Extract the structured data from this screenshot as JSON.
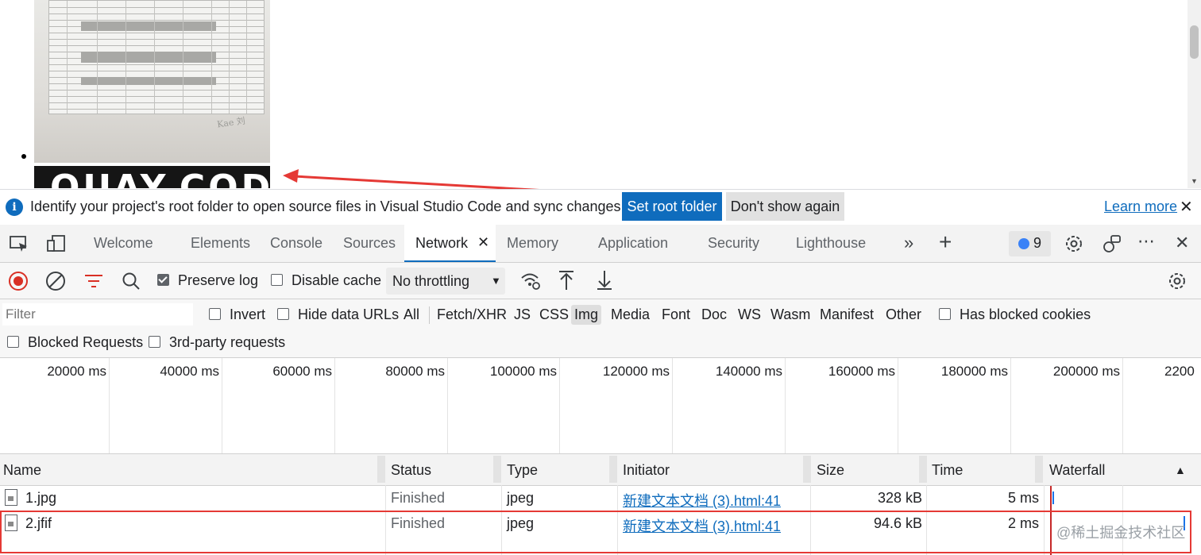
{
  "preview": {
    "photo2_text": "OUAY.COD",
    "signature": "Kae 刘"
  },
  "infobar": {
    "message": "Identify your project's root folder to open source files in Visual Studio Code and sync changes.",
    "set_root_label": "Set root folder",
    "dont_show_label": "Don't show again",
    "learn_more_label": "Learn more"
  },
  "tabs": [
    {
      "label": "Welcome"
    },
    {
      "label": "Elements"
    },
    {
      "label": "Console"
    },
    {
      "label": "Sources"
    },
    {
      "label": "Network"
    },
    {
      "label": "Memory"
    },
    {
      "label": "Application"
    },
    {
      "label": "Security"
    },
    {
      "label": "Lighthouse"
    }
  ],
  "issues_count": "9",
  "toolbar": {
    "preserve_log_label": "Preserve log",
    "preserve_log_checked": true,
    "disable_cache_label": "Disable cache",
    "disable_cache_checked": false,
    "throttling_value": "No throttling"
  },
  "filter": {
    "placeholder": "Filter",
    "invert_label": "Invert",
    "hide_data_urls_label": "Hide data URLs",
    "types": [
      "All",
      "Fetch/XHR",
      "JS",
      "CSS",
      "Img",
      "Media",
      "Font",
      "Doc",
      "WS",
      "Wasm",
      "Manifest",
      "Other"
    ],
    "selected_type": "Img",
    "has_blocked_cookies_label": "Has blocked cookies",
    "blocked_requests_label": "Blocked Requests",
    "third_party_label": "3rd-party requests"
  },
  "overview_ticks": [
    "20000 ms",
    "40000 ms",
    "60000 ms",
    "80000 ms",
    "100000 ms",
    "120000 ms",
    "140000 ms",
    "160000 ms",
    "180000 ms",
    "200000 ms",
    "2200"
  ],
  "table": {
    "columns": [
      "Name",
      "Status",
      "Type",
      "Initiator",
      "Size",
      "Time",
      "Waterfall"
    ],
    "rows": [
      {
        "name": "1.jpg",
        "status": "Finished",
        "type": "jpeg",
        "initiator": "新建文本文档 (3).html:41",
        "size": "328 kB",
        "time": "5 ms"
      },
      {
        "name": "2.jfif",
        "status": "Finished",
        "type": "jpeg",
        "initiator": "新建文本文档 (3).html:41",
        "size": "94.6 kB",
        "time": "2 ms"
      }
    ]
  },
  "watermark": "@稀土掘金技术社区",
  "colors": {
    "accent": "#0f6cbd",
    "highlight_box": "#e53935",
    "record_button": "#d93025"
  }
}
